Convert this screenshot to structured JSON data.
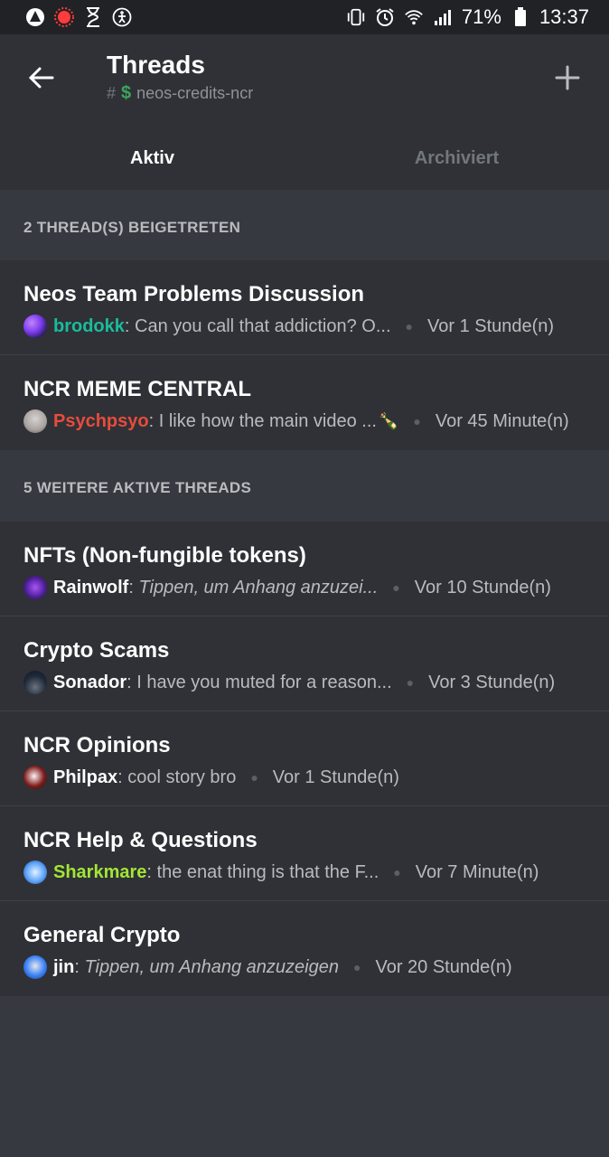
{
  "status_bar": {
    "battery": "71%",
    "time": "13:37"
  },
  "header": {
    "title": "Threads",
    "channel_hash": "#",
    "channel_dollar": "$",
    "channel_name": "neos-credits-ncr"
  },
  "tabs": [
    {
      "label": "Aktiv"
    },
    {
      "label": "Archiviert"
    }
  ],
  "joined": {
    "heading": "2 THREAD(S) BEIGETRETEN",
    "threads": [
      {
        "title": "Neos Team Problems Discussion",
        "author": "brodokk",
        "author_color": "#1abc9c",
        "message": "Can you call that addiction? O...",
        "time": "Vor 1 Stunde(n)"
      },
      {
        "title": "NCR MEME CENTRAL",
        "author": "Psychpsyo",
        "author_color": "#e74c3c",
        "message": "I like how the main video ...",
        "emoji": "🍾",
        "time": "Vor 45 Minute(n)"
      }
    ]
  },
  "active": {
    "heading": "5 WEITERE AKTIVE THREADS",
    "threads": [
      {
        "title": "NFTs (Non-fungible tokens)",
        "author": "Rainwolf",
        "author_color": "#ffffff",
        "message": "Tippen, um Anhang anzuzei...",
        "italic": true,
        "time": "Vor 10 Stunde(n)"
      },
      {
        "title": "Crypto Scams",
        "author": "Sonador",
        "author_color": "#ffffff",
        "message": "I have you muted for a reason...",
        "time": "Vor 3 Stunde(n)"
      },
      {
        "title": "NCR Opinions",
        "author": "Philpax",
        "author_color": "#ffffff",
        "message": "cool story bro",
        "time": "Vor 1 Stunde(n)"
      },
      {
        "title": "NCR Help & Questions",
        "author": "Sharkmare",
        "author_color": "#a3e635",
        "message": "the enat thing is that the F...",
        "time": "Vor 7 Minute(n)"
      },
      {
        "title": "General Crypto",
        "author": "jin",
        "author_color": "#ffffff",
        "message": "Tippen, um Anhang anzuzeigen",
        "italic": true,
        "time": "Vor 20 Stunde(n)"
      }
    ]
  }
}
